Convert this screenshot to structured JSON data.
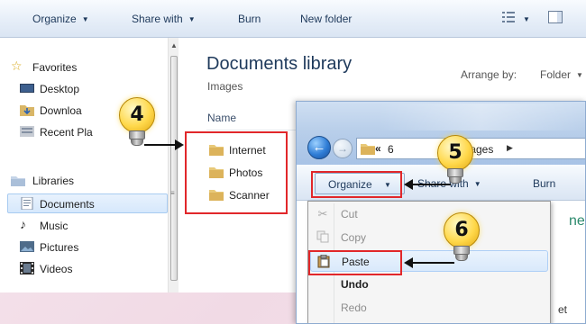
{
  "back_window": {
    "toolbar": {
      "organize": "Organize",
      "share_with": "Share with",
      "burn": "Burn",
      "new_folder": "New folder"
    },
    "nav": {
      "favorites": "Favorites",
      "desktop": "Desktop",
      "downloads": "Downloa",
      "recent_places": "Recent Pla",
      "libraries": "Libraries",
      "documents": "Documents",
      "music": "Music",
      "pictures": "Pictures",
      "videos": "Videos"
    },
    "content": {
      "title": "Documents library",
      "subtitle": "Images",
      "arrange_by_label": "Arrange by:",
      "arrange_by_value": "Folder",
      "column_name": "Name",
      "files": [
        "Internet",
        "Photos",
        "Scanner"
      ]
    }
  },
  "front_window": {
    "address": {
      "chevrons": "«",
      "segment_1": "6",
      "segment_2": "Images"
    },
    "toolbar": {
      "organize": "Organize",
      "share_with": "Share with",
      "burn": "Burn"
    },
    "partial_heading": "nen",
    "partial_text": "et",
    "menu": {
      "items": [
        {
          "label": "Cut",
          "state": "disabled"
        },
        {
          "label": "Copy",
          "state": "disabled"
        },
        {
          "label": "Paste",
          "state": "highlighted"
        },
        {
          "label": "Undo",
          "state": "bold"
        },
        {
          "label": "Redo",
          "state": "disabled"
        }
      ]
    }
  },
  "callouts": {
    "step_4": "4",
    "step_5": "5",
    "step_6": "6"
  },
  "colors": {
    "highlight_box": "#e1272a",
    "bulb": "#ffd84a",
    "background": "#f3e0e9"
  }
}
